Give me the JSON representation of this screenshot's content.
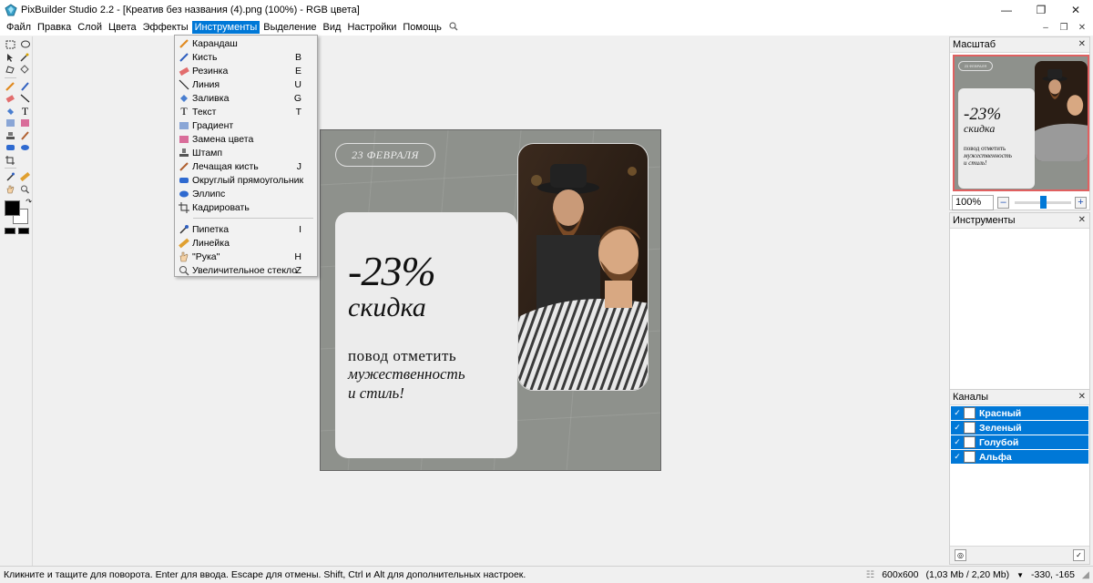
{
  "window": {
    "title": "PixBuilder Studio 2.2 - [Креатив без названия (4).png (100%) - RGB цвета]",
    "controls": [
      "minimize-icon",
      "maximize-icon",
      "close-icon"
    ]
  },
  "menubar": {
    "items": [
      "Файл",
      "Правка",
      "Слой",
      "Цвета",
      "Эффекты",
      "Инструменты",
      "Выделение",
      "Вид",
      "Настройки",
      "Помощь"
    ],
    "active": "Инструменты"
  },
  "tools_menu": {
    "group1": [
      {
        "label": "Карандаш",
        "key": "",
        "icon": "pencil-icon"
      },
      {
        "label": "Кисть",
        "key": "B",
        "icon": "brush-icon"
      },
      {
        "label": "Резинка",
        "key": "E",
        "icon": "eraser-icon"
      },
      {
        "label": "Линия",
        "key": "U",
        "icon": "line-icon"
      },
      {
        "label": "Заливка",
        "key": "G",
        "icon": "fill-bucket-icon"
      },
      {
        "label": "Текст",
        "key": "T",
        "icon": "text-icon"
      },
      {
        "label": "Градиент",
        "key": "",
        "icon": "gradient-icon"
      },
      {
        "label": "Замена цвета",
        "key": "",
        "icon": "color-replace-icon"
      },
      {
        "label": "Штамп",
        "key": "",
        "icon": "stamp-icon"
      },
      {
        "label": "Лечащая кисть",
        "key": "J",
        "icon": "healing-brush-icon"
      },
      {
        "label": "Округлый прямоугольник",
        "key": "",
        "icon": "rounded-rectangle-icon"
      },
      {
        "label": "Эллипс",
        "key": "",
        "icon": "ellipse-icon"
      },
      {
        "label": "Кадрировать",
        "key": "",
        "icon": "crop-icon"
      }
    ],
    "group2": [
      {
        "label": "Пипетка",
        "key": "I",
        "icon": "eyedropper-icon"
      },
      {
        "label": "Линейка",
        "key": "",
        "icon": "ruler-icon"
      },
      {
        "label": "\"Рука\"",
        "key": "H",
        "icon": "hand-icon"
      },
      {
        "label": "Увеличительное стекло",
        "key": "Z",
        "icon": "magnifier-icon"
      }
    ]
  },
  "canvas_image": {
    "date": "23 ФЕВРАЛЯ",
    "discount": "-23%",
    "discount_word": "скидка",
    "line1": "повод отметить",
    "line2": "мужественность",
    "line3": "и стиль!"
  },
  "navigator": {
    "title": "Масштаб",
    "zoom": "100%",
    "zoom_level": 0.5,
    "preview_date": "23 ФЕВРАЛЯ",
    "preview_discount": "-23%",
    "preview_word": "скидка",
    "preview_line1": "повод отметить",
    "preview_line2": "мужественность",
    "preview_line3": "и стиль!"
  },
  "tools_panel": {
    "title": "Инструменты"
  },
  "channels": {
    "title": "Каналы",
    "items": [
      "Красный",
      "Зеленый",
      "Голубой",
      "Альфа"
    ]
  },
  "statusbar": {
    "message": "Кликните и тащите для поворота. Enter для ввода. Escape для отмены. Shift, Ctrl и Alt для дополнительных настроек.",
    "size": "600x600",
    "memory": "(1,03 Mb / 2,20 Mb)",
    "coords": "-330, -165"
  },
  "colors": {
    "accent": "#0078d7",
    "canvas_bg": "#8e918c",
    "card_bg": "#ececec",
    "foreground": "#000000",
    "background": "#ffffff"
  }
}
